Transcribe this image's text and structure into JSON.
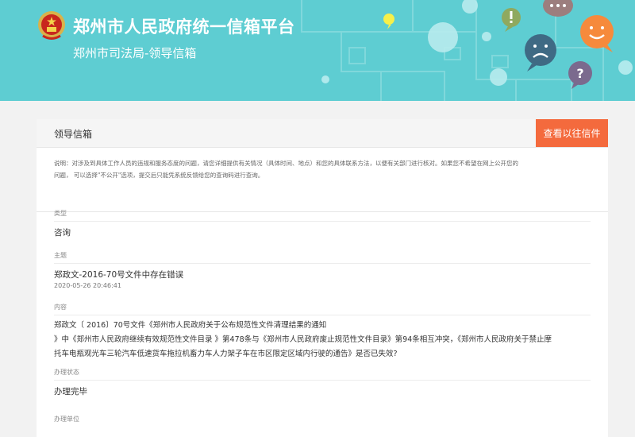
{
  "header": {
    "site_title": "郑州市人民政府统一信箱平台",
    "subtitle": "郑州市司法局-领导信箱"
  },
  "panel": {
    "title": "领导信箱",
    "history_button": "查看以往信件",
    "notice_lines": [
      "说明：对涉及到具体工作人员的违规和服务态度的问题，请您详细提供有关情况（具体时间、地点）和您的具体联系方法，以便有关部门进行核对。如果您不希望在网上公开您的",
      "问题， 可以选择\"不公开\"选项，提交后只能凭系统反馈给您的查询码进行查询。"
    ]
  },
  "letter": {
    "type_label": "类型",
    "type_value": "咨询",
    "subject_label": "主题",
    "subject_value": "郑政文-2016-70号文件中存在错误",
    "date": "2020-05-26 20:46:41",
    "content_label": "内容",
    "content_lines": [
      "郑政文〔 2016〕70号文件《郑州市人民政府关于公布规范性文件清理结果的通知",
      "》中《郑州市人民政府继续有效规范性文件目录 》第478条与《郑州市人民政府废止规范性文件目录》第94条相互冲突，《郑州市人民政府关于禁止摩",
      "托车电瓶观光车三轮汽车低速货车拖拉机畜力车人力架子车在市区限定区域内行驶的通告》是否已失效?"
    ],
    "status_label": "办理状态",
    "status_value": "办理完毕",
    "unit_label": "办理单位"
  },
  "colors": {
    "banner": "#5ecdd2",
    "accent_button": "#f46a3d"
  },
  "icons": [
    "national-emblem-icon",
    "exclamation-bubble-icon",
    "ellipsis-bubble-icon",
    "smile-bubble-icon",
    "sad-bubble-icon",
    "question-bubble-icon"
  ]
}
